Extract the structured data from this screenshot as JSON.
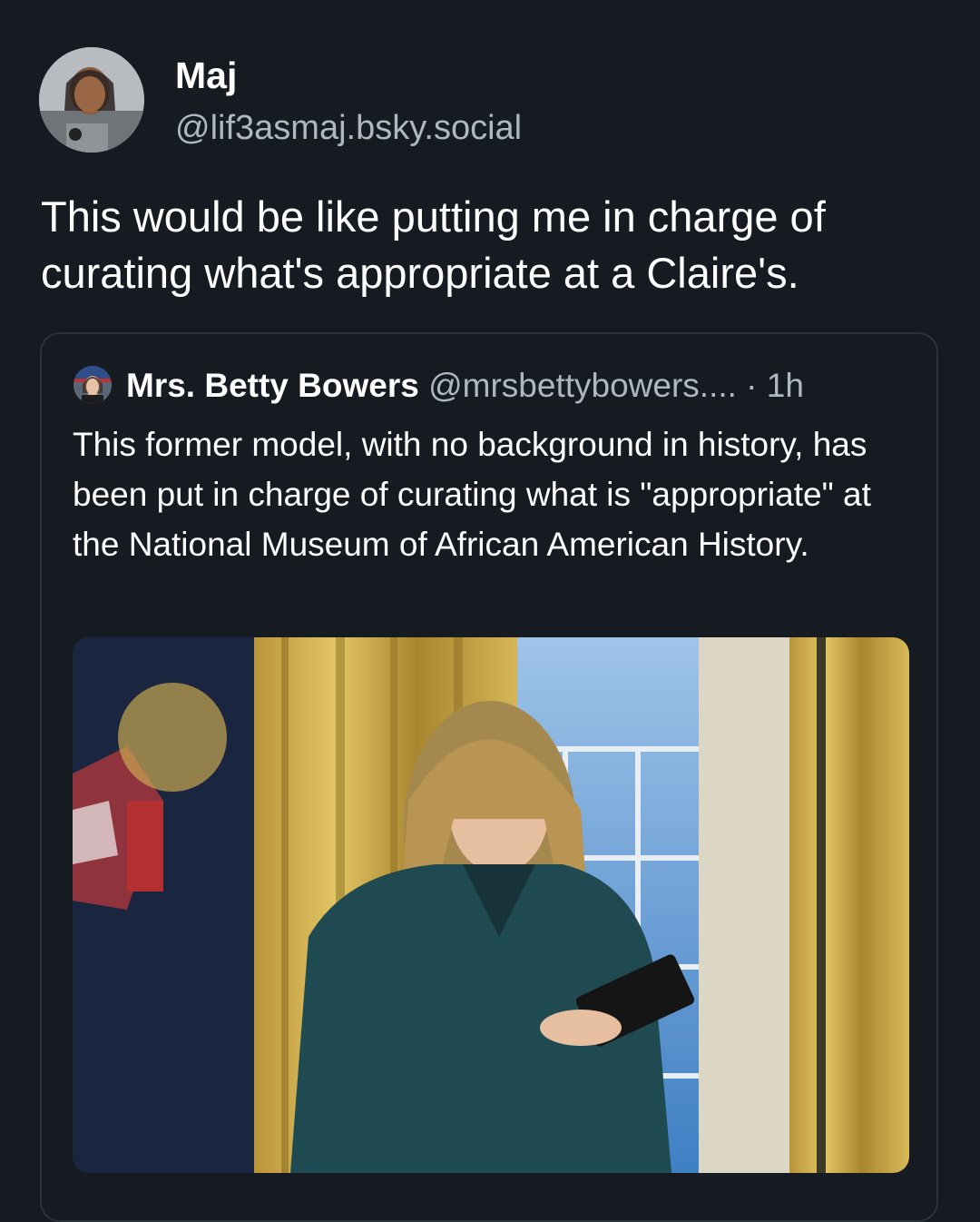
{
  "author": {
    "display_name": "Maj",
    "handle": "@lif3asmaj.bsky.social",
    "avatar_icon": "user-avatar-photo"
  },
  "post": {
    "text": "This would be like putting me in charge of curating what's appropriate at a Claire's."
  },
  "quoted_post": {
    "display_name": "Mrs. Betty Bowers",
    "handle": "@mrsbettybowers....",
    "separator": " · ",
    "time": "1h",
    "text": "This former model, with no background in history, has been put in charge of curating what is \"appropriate\" at the National Museum of African American History.",
    "avatar_icon": "user-avatar-photo",
    "image_icon": "photo-woman-in-oval-office"
  },
  "colors": {
    "background": "#161b22",
    "text_primary": "#ffffff",
    "text_secondary": "#aeb7c2",
    "card_border": "#2b323b"
  }
}
